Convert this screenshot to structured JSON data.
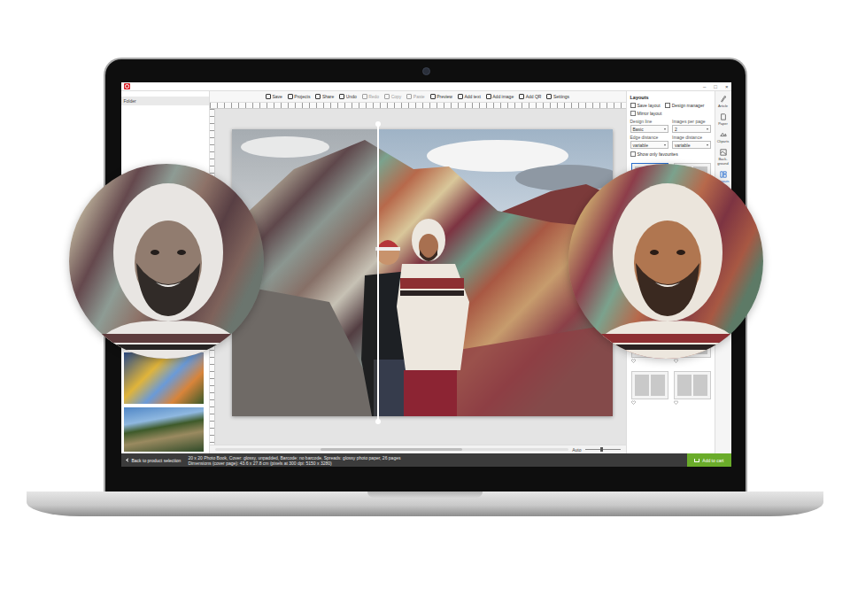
{
  "window_controls": [
    "–",
    "□",
    "×"
  ],
  "toolbar": [
    {
      "label": "Save",
      "disabled": false
    },
    {
      "label": "Projects",
      "disabled": false
    },
    {
      "label": "Share",
      "disabled": false
    },
    {
      "label": "Undo",
      "disabled": false
    },
    {
      "label": "Redo",
      "disabled": true
    },
    {
      "label": "Copy",
      "disabled": true
    },
    {
      "label": "Paste",
      "disabled": true
    },
    {
      "label": "Preview",
      "disabled": false
    },
    {
      "label": "Add text",
      "disabled": false
    },
    {
      "label": "Add image",
      "disabled": false
    },
    {
      "label": "Add QR",
      "disabled": false
    },
    {
      "label": "Settings",
      "disabled": false
    }
  ],
  "left_panel": {
    "title": "Folder"
  },
  "comparison": {
    "level": 0.386
  },
  "zoom": {
    "label": "Auto",
    "level": 0.45
  },
  "layouts_panel": {
    "title": "Layouts",
    "actions": [
      "Save layout",
      "Design manager"
    ],
    "mirror": {
      "label": "Mirror layout",
      "checked": false
    },
    "fields": [
      {
        "label": "Design line",
        "value": "Basic"
      },
      {
        "label": "Images per page",
        "value": "2"
      },
      {
        "label": "Edge distance",
        "value": "variable"
      },
      {
        "label": "Image distance",
        "value": "variable"
      }
    ],
    "favourites": {
      "label": "Show only favourites",
      "checked": false
    },
    "thumbnails": [
      {
        "selected": true,
        "favourite": false
      },
      {
        "selected": false,
        "favourite": false
      },
      {
        "selected": false,
        "favourite": false
      },
      {
        "selected": false,
        "favourite": false
      },
      {
        "selected": false,
        "favourite": false
      },
      {
        "selected": false,
        "favourite": false
      },
      {
        "selected": false,
        "favourite": false
      },
      {
        "selected": false,
        "favourite": false
      },
      {
        "selected": false,
        "favourite": false
      },
      {
        "selected": false,
        "favourite": false
      },
      {
        "selected": false,
        "favourite": false
      },
      {
        "selected": false,
        "favourite": false
      }
    ]
  },
  "side_tools": [
    {
      "label": "Article",
      "selected": false
    },
    {
      "label": "Paper",
      "selected": false
    },
    {
      "label": "Cliparts",
      "selected": false
    },
    {
      "label": "Back-ground",
      "selected": false
    },
    {
      "label": "Layouts",
      "selected": true
    }
  ],
  "footer": {
    "back": "Back to product selection",
    "status": [
      "20 x 20 Photo Book, Cover: glossy, unpadded, Barcode: no barcode, Spreads: glossy photo paper, 26 pages",
      "Dimensions (cover page): 43.6 x 27.8 cm (pixels at 300 dpi: 5150 x 3280)"
    ],
    "cart": "Add to cart"
  }
}
